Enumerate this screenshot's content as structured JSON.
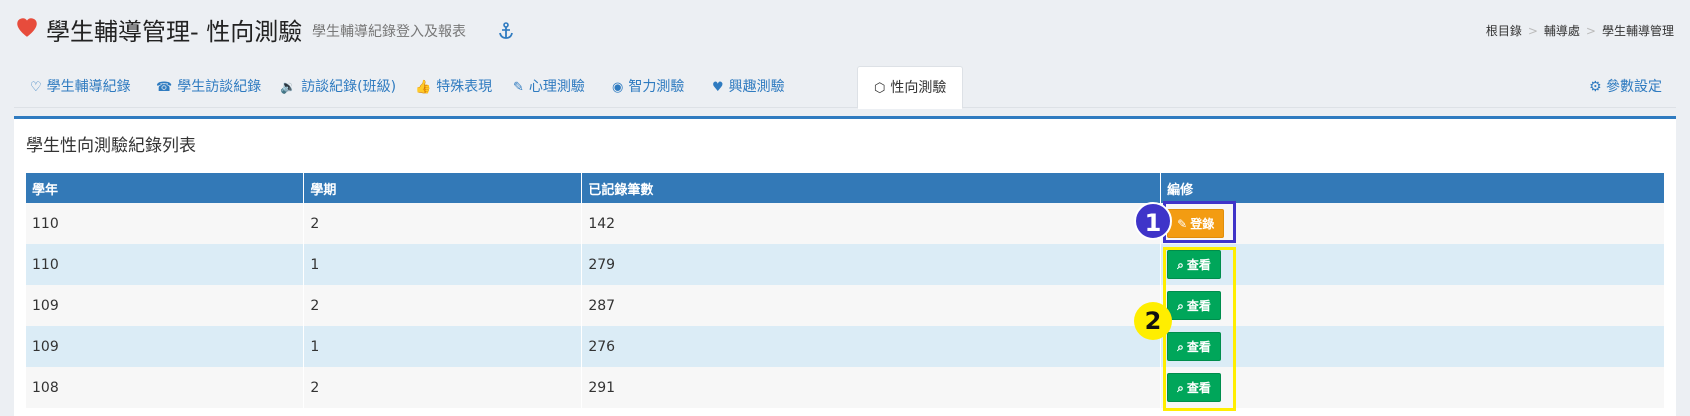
{
  "header": {
    "title": "學生輔導管理- 性向測驗",
    "subtitle": "學生輔導紀錄登入及報表",
    "icons": {
      "title": "heart-icon",
      "subtitle": "anchor-icon"
    },
    "colors": {
      "heart": "#e74c3c",
      "accent": "#2f7bc0"
    }
  },
  "breadcrumb": [
    "根目錄",
    "輔導處",
    "學生輔導管理"
  ],
  "tabs": [
    {
      "label": "學生輔導紀錄",
      "icon": "heart-outline-icon"
    },
    {
      "label": "學生訪談紀錄",
      "icon": "phone-icon"
    },
    {
      "label": "訪談紀錄(班級)",
      "icon": "volume-icon"
    },
    {
      "label": "特殊表現",
      "icon": "thumbs-up-icon"
    },
    {
      "label": "心理測驗",
      "icon": "edit-icon"
    },
    {
      "label": "智力測驗",
      "icon": "eye-icon"
    },
    {
      "label": "興趣測驗",
      "icon": "heartbeat-icon"
    },
    {
      "label": "性向測驗",
      "icon": "cubes-icon",
      "active": true
    }
  ],
  "settings": {
    "label": "參數設定",
    "icon": "gear-icon"
  },
  "panel": {
    "title": "學生性向測驗紀錄列表",
    "columns": [
      "學年",
      "學期",
      "已記錄筆數",
      "編修"
    ],
    "rows": [
      {
        "year": "110",
        "term": "2",
        "count": "142",
        "action": "登錄"
      },
      {
        "year": "110",
        "term": "1",
        "count": "279",
        "action": "查看"
      },
      {
        "year": "109",
        "term": "2",
        "count": "287",
        "action": "查看"
      },
      {
        "year": "109",
        "term": "1",
        "count": "276",
        "action": "查看"
      },
      {
        "year": "108",
        "term": "2",
        "count": "291",
        "action": "查看"
      }
    ]
  },
  "annotations": [
    {
      "label": "1",
      "color": "#3f34c9"
    },
    {
      "label": "2",
      "color": "#ffee00"
    }
  ]
}
